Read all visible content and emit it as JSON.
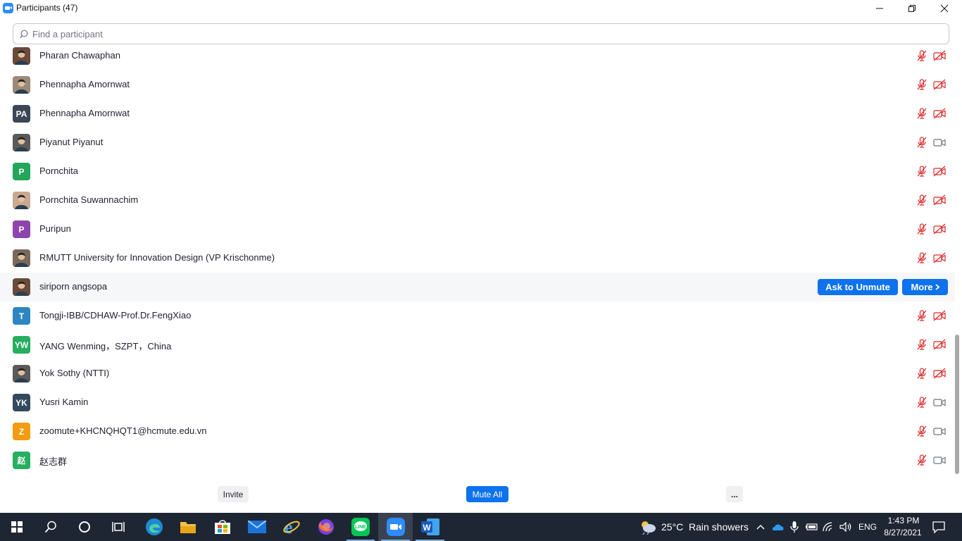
{
  "window": {
    "title": "Participants (47)"
  },
  "search": {
    "placeholder": "Find a participant",
    "value": ""
  },
  "participants": [
    {
      "name": "Pharan Chawaphan",
      "avatar": "photo",
      "video_on": false
    },
    {
      "name": "Phennapha Amornwat",
      "avatar": "photo",
      "video_on": false
    },
    {
      "name": "Phennapha Amornwat",
      "initials": "PA",
      "color": "#3b4757",
      "video_on": false
    },
    {
      "name": "Piyanut Piyanut",
      "avatar": "photo",
      "video_on": true
    },
    {
      "name": "Pornchita",
      "initials": "P",
      "color": "#23a55a",
      "video_on": false
    },
    {
      "name": "Pornchita Suwannachim",
      "avatar": "photo",
      "video_on": false
    },
    {
      "name": "Puripun",
      "initials": "P",
      "color": "#8e44ad",
      "video_on": false
    },
    {
      "name": "RMUTT University for Innovation Design (VP Krischonme)",
      "avatar": "photo",
      "video_on": false
    },
    {
      "name": "siriporn angsopa",
      "avatar": "photo",
      "hovered": true
    },
    {
      "name": "Tongji-IBB/CDHAW-Prof.Dr.FengXiao",
      "initials": "T",
      "color": "#2e86c1",
      "video_on": false
    },
    {
      "name": "YANG Wenming，SZPT，China",
      "initials": "YW",
      "color": "#27ae60",
      "video_on": false
    },
    {
      "name": "Yok Sothy (NTTI)",
      "avatar": "photo",
      "video_on": false
    },
    {
      "name": "Yusri Kamin",
      "initials": "YK",
      "color": "#34495e",
      "video_on": true
    },
    {
      "name": "zoomute+KHCNQHQT1@hcmute.edu.vn",
      "initials": "Z",
      "color": "#f39c12",
      "video_on": true
    },
    {
      "name": "赵志群",
      "initials": "赵",
      "color": "#27ae60",
      "video_on": true
    }
  ],
  "row_actions": {
    "ask_to_unmute": "Ask to Unmute",
    "more": "More"
  },
  "footer": {
    "invite": "Invite",
    "mute_all": "Mute All",
    "more": "..."
  },
  "colors": {
    "accent": "#0e72ed",
    "muted_red": "#e02828"
  },
  "taskbar": {
    "weather": {
      "temp": "25°C",
      "desc": "Rain showers"
    },
    "language": "ENG",
    "time": "1:43 PM",
    "date": "8/27/2021"
  }
}
